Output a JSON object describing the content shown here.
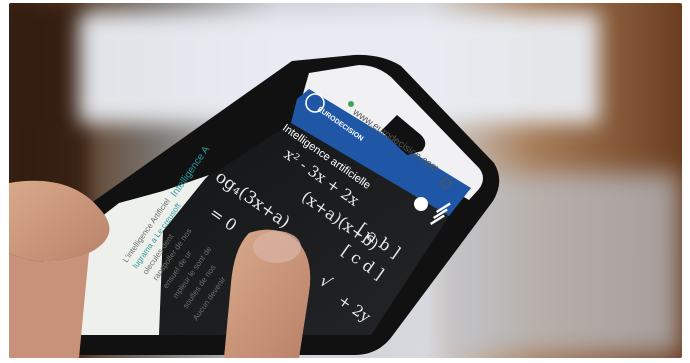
{
  "photo": {
    "description_colors": {
      "background_brown": "#6b3d1f",
      "window_light": "#e9edf3",
      "phone_body": "#121212",
      "brand_blue": "#1f56a6",
      "teal_text": "#2f9aa0"
    },
    "browser_url": "www.eurodecision.com",
    "brand_name": "EURODECISION",
    "screen_title": "Intelligence artificielle",
    "math_lines": [
      "x² - 3x + 2x",
      "og₄(3x+a)",
      "(x+a)(x+b)",
      "[ a b ]",
      "[ c d ]",
      "= 0",
      "√",
      "+ 2y"
    ],
    "article_teal": "Intelligence A",
    "article_text": [
      "L'intelligence Artificiel",
      "lugrama a Le creusoft",
      "olecules dent",
      "ranspoller de nos",
      "ensuel de ur",
      "mpleur le sont de",
      "soulles de nos",
      "Aucun devenir"
    ]
  }
}
